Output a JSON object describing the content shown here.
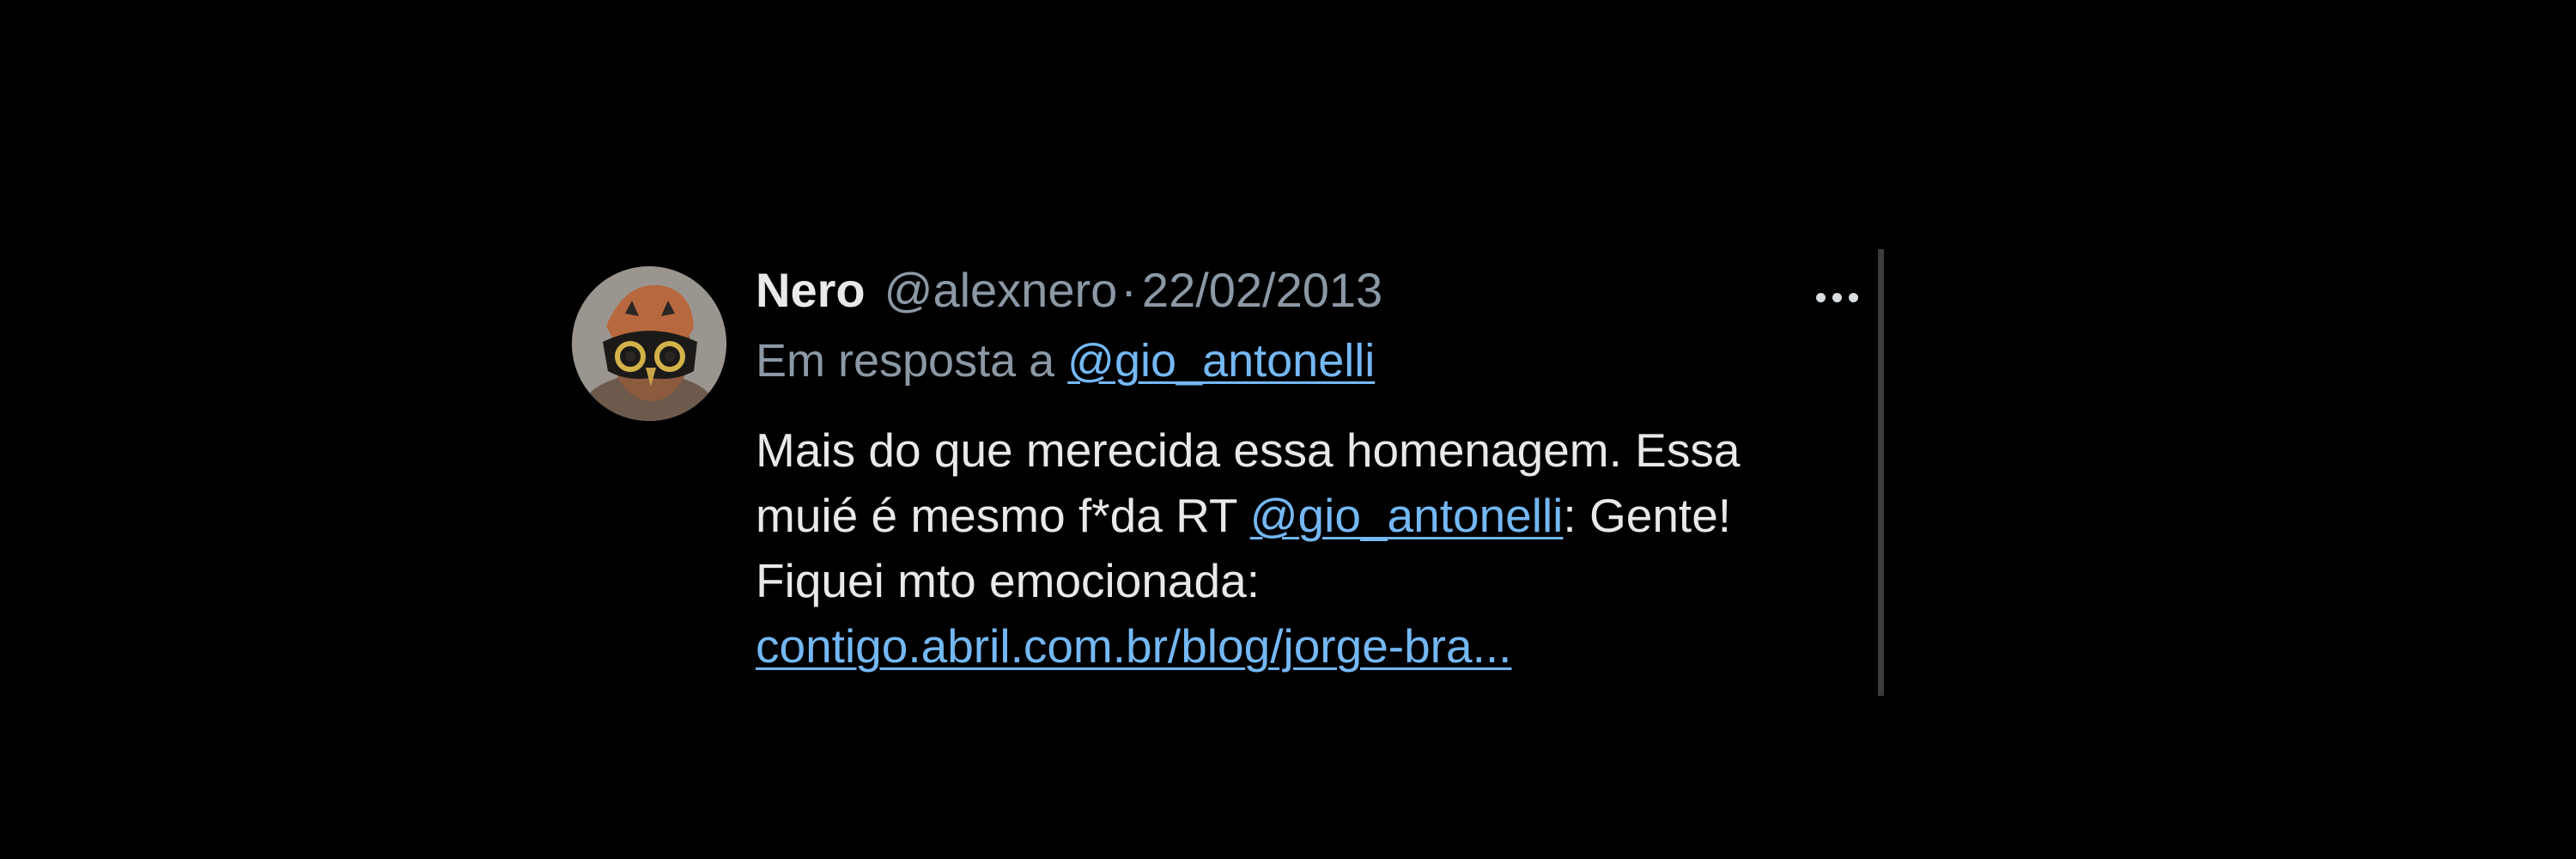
{
  "tweet": {
    "author": {
      "display_name": "Nero",
      "handle": "@alexnero",
      "avatar_icon": "masked-face-avatar"
    },
    "separator": "·",
    "date": "22/02/2013",
    "reply": {
      "prefix": "Em resposta a",
      "mention": "@gio_antonelli"
    },
    "text": {
      "line1": "Mais do que merecida essa homenagem. Essa",
      "line2_before": "muié é mesmo f*da RT ",
      "line2_mention": "@gio_antonelli",
      "line2_after": ": Gente!",
      "line3": "Fiquei mto emocionada:",
      "link": "contigo.abril.com.br/blog/jorge-bra..."
    },
    "more_icon": "more-horizontal-icon",
    "colors": {
      "background": "#000000",
      "primary_text": "#e7e9ea",
      "secondary_text": "#8b98a5",
      "link": "#74b8f4",
      "divider": "#3a3d40"
    }
  }
}
